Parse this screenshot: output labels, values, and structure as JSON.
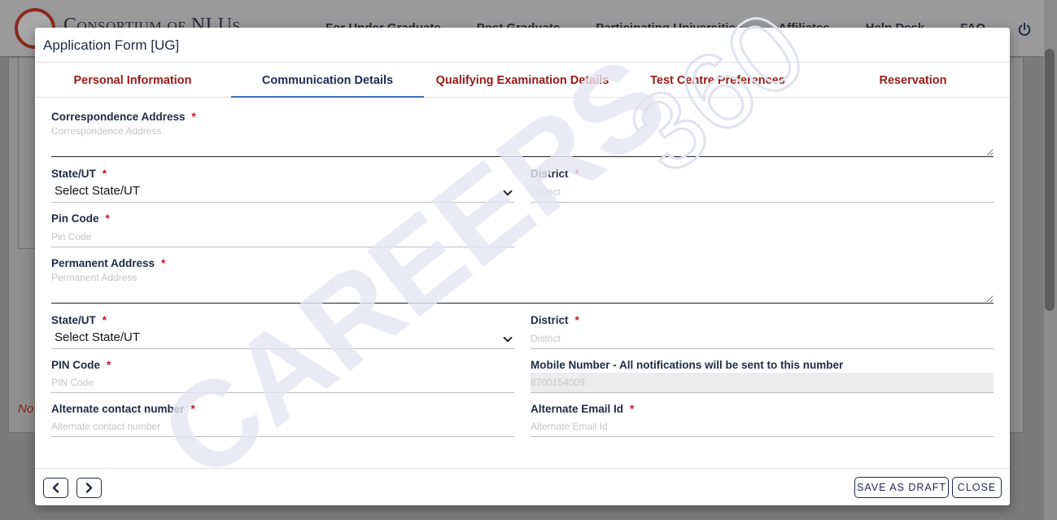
{
  "background": {
    "brand": "Consortium of NLUs",
    "nav": [
      "For Under Graduate",
      "Post Graduate",
      "Participating Universities",
      "Affiliates",
      "Help Desk",
      "FAQ"
    ],
    "note": "No"
  },
  "modal": {
    "title": "Application Form [UG]",
    "tabs": [
      {
        "label": "Personal Information",
        "active": false
      },
      {
        "label": "Communication Details",
        "active": true
      },
      {
        "label": "Qualifying Examination Details",
        "active": false
      },
      {
        "label": "Test Centre Preferences",
        "active": false
      },
      {
        "label": "Reservation",
        "active": false
      }
    ],
    "form": {
      "correspondence_address": {
        "label": "Correspondence Address",
        "required": "*",
        "placeholder": "Correspondence Address"
      },
      "state1": {
        "label": "State/UT",
        "required": "*",
        "value": "Select State/UT"
      },
      "district1": {
        "label": "District",
        "required": "*",
        "placeholder": "District"
      },
      "pincode1": {
        "label": "Pin Code",
        "required": "*",
        "placeholder": "Pin Code"
      },
      "permanent_address": {
        "label": "Permanent Address",
        "required": "*",
        "placeholder": "Permanent Address"
      },
      "state2": {
        "label": "State/UT",
        "required": "*",
        "value": "Select State/UT"
      },
      "district2": {
        "label": "District",
        "required": "*",
        "placeholder": "District"
      },
      "pincode2": {
        "label": "PIN Code",
        "required": "*",
        "placeholder": "PIN Code"
      },
      "mobile": {
        "label": "Mobile Number - All notifications will be sent to this number",
        "value": "8700154009"
      },
      "alt_contact": {
        "label": "Alternate contact number",
        "required": "*",
        "placeholder": "Alternate contact number"
      },
      "alt_email": {
        "label": "Alternate Email Id",
        "required": "*",
        "placeholder": "Alternate Email Id"
      }
    },
    "footer": {
      "save_draft": "SAVE AS DRAFT",
      "close": "CLOSE"
    }
  },
  "watermark": {
    "brand": "CAREERS",
    "number": "360"
  },
  "colors": {
    "tab_text": "#9a1c17",
    "tab_active": "#1f2a5a",
    "required": "#c8102e",
    "watermark": "#d9dcec"
  }
}
